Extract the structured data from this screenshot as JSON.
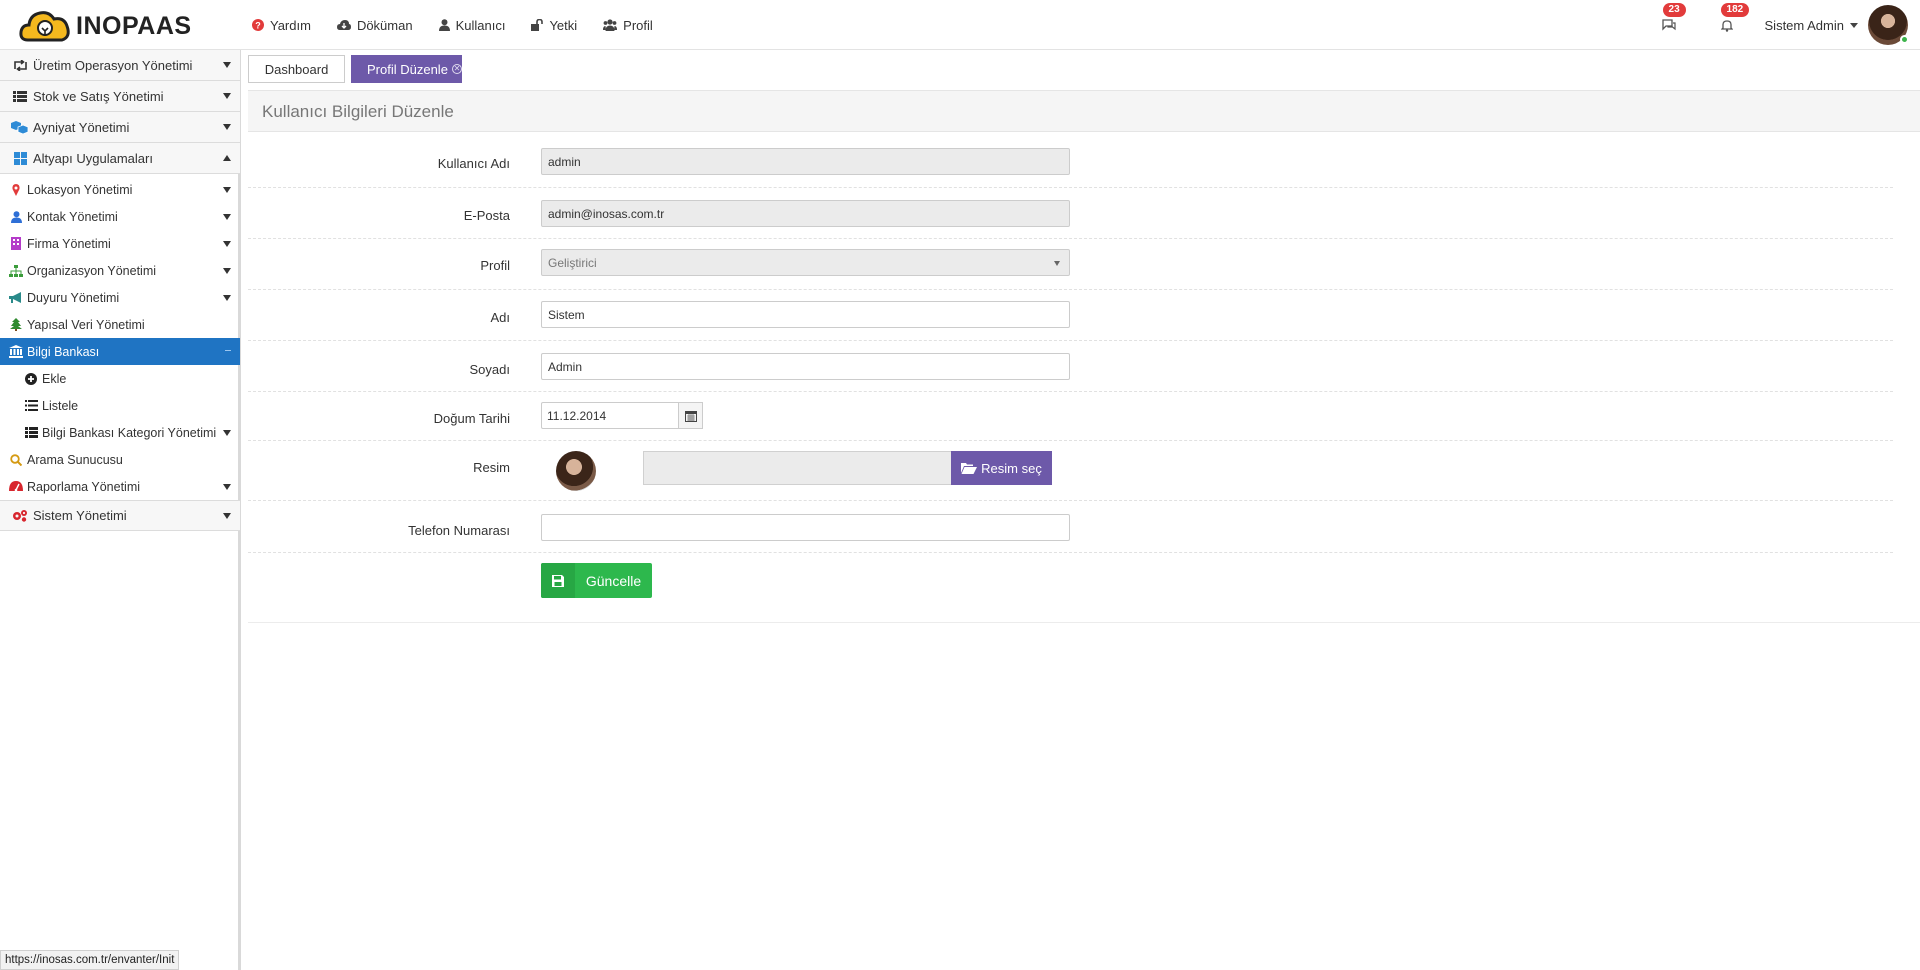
{
  "app": {
    "name": "INOPAAS"
  },
  "topnav": [
    {
      "label": "Yardım",
      "icon": "question-circle-icon"
    },
    {
      "label": "Döküman",
      "icon": "cloud-download-icon"
    },
    {
      "label": "Kullanıcı",
      "icon": "user-icon"
    },
    {
      "label": "Yetki",
      "icon": "unlock-icon"
    },
    {
      "label": "Profil",
      "icon": "users-icon"
    }
  ],
  "header": {
    "messages_count": "23",
    "notifications_count": "182",
    "user_name": "Sistem Admin"
  },
  "sidebar": {
    "items": [
      {
        "label": "Üretim Operasyon Yönetimi",
        "icon": "retweet-icon"
      },
      {
        "label": "Stok ve Satış Yönetimi",
        "icon": "list-icon"
      },
      {
        "label": "Ayniyat Yönetimi",
        "icon": "cubes-icon"
      },
      {
        "label": "Altyapı Uygulamaları",
        "icon": "th-large-icon"
      },
      {
        "label": "Lokasyon Yönetimi",
        "icon": "map-marker-icon"
      },
      {
        "label": "Kontak Yönetimi",
        "icon": "user-icon"
      },
      {
        "label": "Firma Yönetimi",
        "icon": "building-icon"
      },
      {
        "label": "Organizasyon Yönetimi",
        "icon": "sitemap-icon"
      },
      {
        "label": "Duyuru Yönetimi",
        "icon": "bullhorn-icon"
      },
      {
        "label": "Yapısal Veri Yönetimi",
        "icon": "tree-icon"
      },
      {
        "label": "Bilgi Bankası",
        "icon": "bank-icon"
      },
      {
        "label": "Ekle",
        "icon": "plus-circle-icon"
      },
      {
        "label": "Listele",
        "icon": "list-icon"
      },
      {
        "label": "Bilgi Bankası Kategori Yönetimi",
        "icon": "th-list-icon"
      },
      {
        "label": "Arama Sunucusu",
        "icon": "search-icon"
      },
      {
        "label": "Raporlama Yönetimi",
        "icon": "dashboard-icon"
      },
      {
        "label": "Sistem Yönetimi",
        "icon": "cogs-icon"
      }
    ]
  },
  "tabs": [
    {
      "label": "Dashboard"
    },
    {
      "label": "Profil Düzenle"
    }
  ],
  "page": {
    "title": "Kullanıcı Bilgileri Düzenle"
  },
  "form": {
    "username_label": "Kullanıcı Adı",
    "username_value": "admin",
    "email_label": "E-Posta",
    "email_value": "admin@inosas.com.tr",
    "profile_label": "Profil",
    "profile_value": "Geliştirici",
    "name_label": "Adı",
    "name_value": "Sistem",
    "surname_label": "Soyadı",
    "surname_value": "Admin",
    "birthdate_label": "Doğum Tarihi",
    "birthdate_value": "11.12.2014",
    "picture_label": "Resim",
    "picture_button": "Resim seç",
    "phone_label": "Telefon Numarası",
    "phone_value": "",
    "save_button": "Güncelle"
  },
  "status_bar": {
    "url": "https://inosas.com.tr/envanter/Init"
  },
  "colors": {
    "accent": "#6d59a9",
    "active_sidebar": "#1f74c3",
    "save_green": "#2db84d",
    "badge_red": "#e23b3b"
  }
}
